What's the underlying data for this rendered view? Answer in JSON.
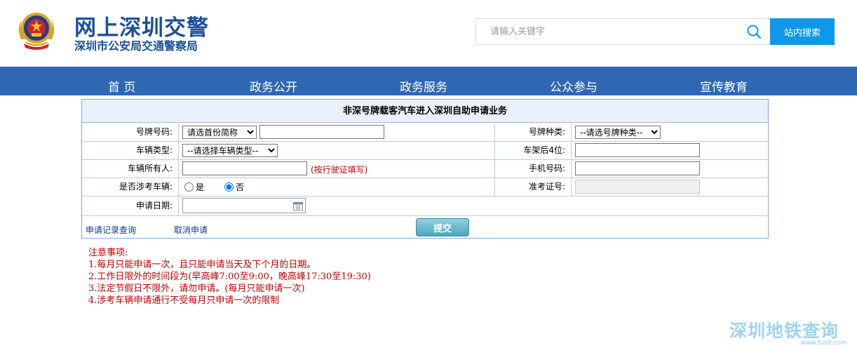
{
  "header": {
    "title": "网上深圳交警",
    "subtitle": "深圳市公安局交通警察局",
    "search_placeholder": "请输入关键字",
    "search_button": "站内搜索"
  },
  "nav": {
    "items": [
      "首 页",
      "政务公开",
      "政务服务",
      "公众参与",
      "宣传教育"
    ]
  },
  "form": {
    "title": "非深号牌载客汽车进入深圳自助申请业务",
    "plate_label": "号牌号码:",
    "province_selected": "请选首份简称",
    "plate_type_label": "号牌种类:",
    "plate_type_selected": "--请选号牌种类--",
    "vehicle_type_label": "车辆类型:",
    "vehicle_type_selected": "--请选择车辆类型--",
    "vin_label": "车架后4位:",
    "owner_label": "车辆所有人:",
    "owner_hint": "(按行驶证填写)",
    "phone_label": "手机号码:",
    "exam_vehicle_label": "是否涉考车辆:",
    "yes_label": "是",
    "no_label": "否",
    "exam_no_label": "准考证号:",
    "date_label": "申请日期:",
    "record_link": "申请记录查询",
    "cancel_link": "取消申请",
    "submit": "提交"
  },
  "notes": [
    "注意事项:",
    "1.每月只能申请一次，且只能申请当天及下个月的日期。",
    "2.工作日限外的时间段为(早高峰7:00至9:00，晚高峰17:30至19:30)",
    "3.法定节假日不限外，请勿申请。(每月只能申请一次)",
    "4.涉考车辆申请通行不受每月只申请一次的限制"
  ],
  "watermark": {
    "text": "深圳地铁查询",
    "url": "www.tus8.com"
  },
  "colors": {
    "brand_blue": "#1b4f9b",
    "nav_blue": "#2f67b3",
    "search_button": "#0e98e9",
    "notice_red": "#c00000"
  }
}
